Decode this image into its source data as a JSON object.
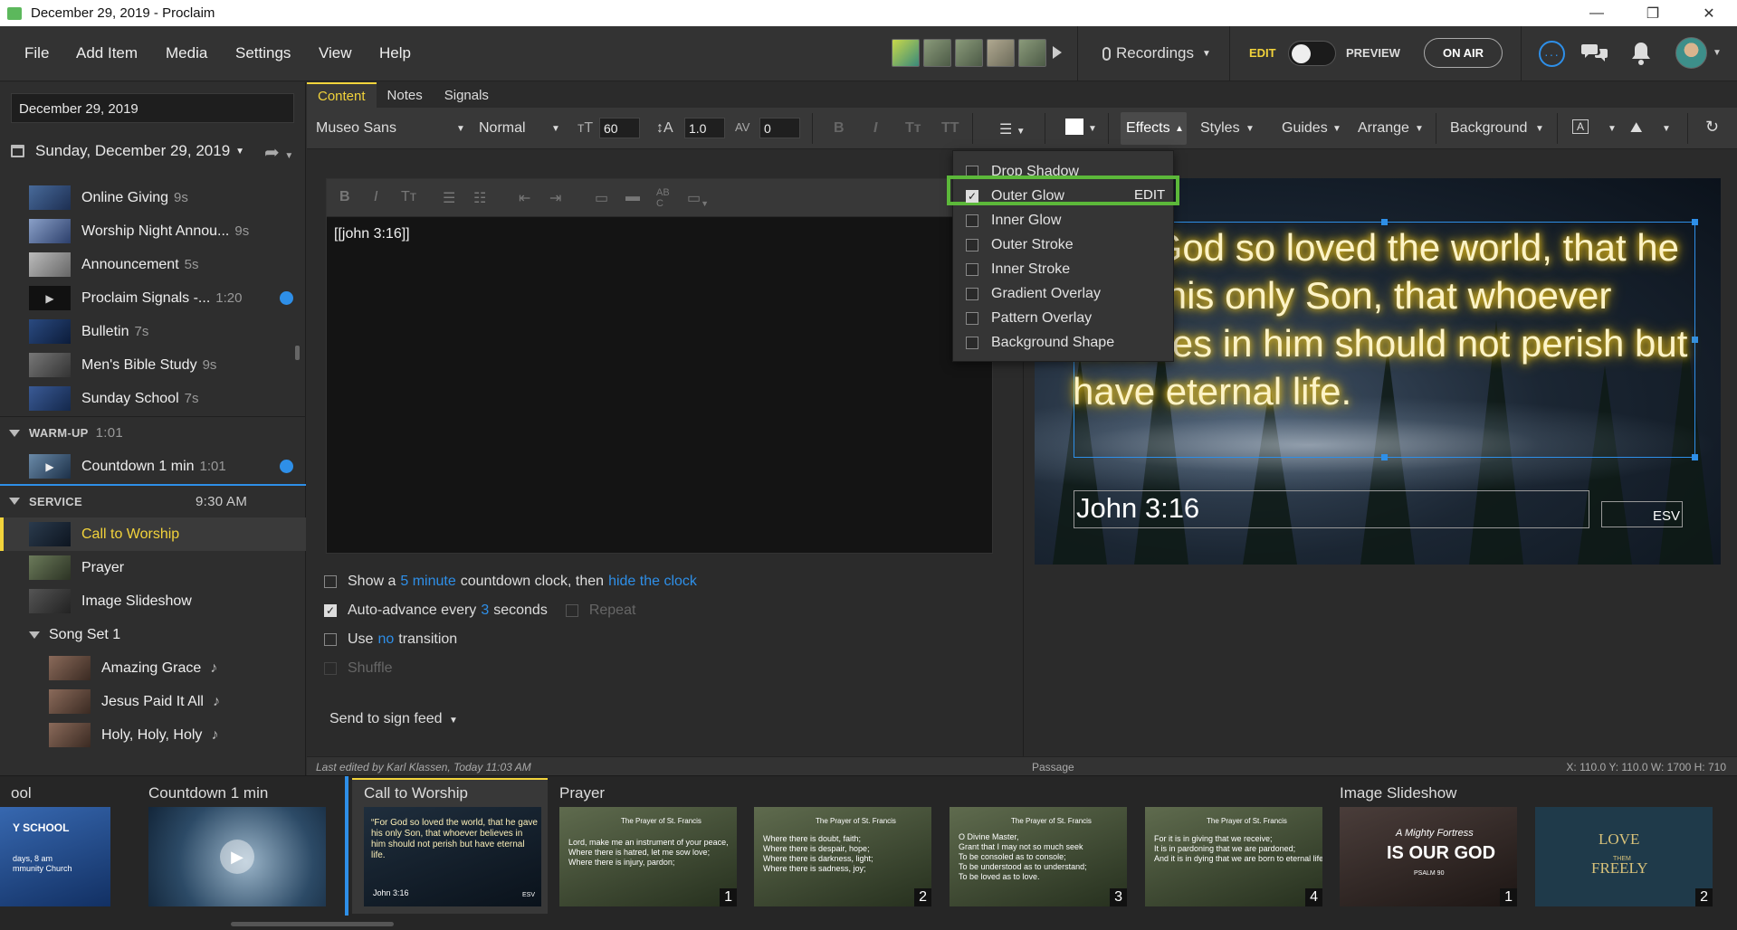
{
  "window": {
    "title": "December 29, 2019 - Proclaim",
    "minimize": "—",
    "restore": "❐",
    "close": "✕"
  },
  "menu": {
    "items": [
      "File",
      "Add Item",
      "Media",
      "Settings",
      "View",
      "Help"
    ]
  },
  "header": {
    "recordings": "Recordings",
    "edit": "EDIT",
    "preview": "PREVIEW",
    "on_air": "ON AIR"
  },
  "sidebar": {
    "date_value": "December 29, 2019",
    "day": "Sunday, December 29, 2019",
    "items": [
      {
        "label": "Online Giving",
        "dur": "9s"
      },
      {
        "label": "Worship Night Annou...",
        "dur": "9s"
      },
      {
        "label": "Announcement",
        "dur": "5s"
      },
      {
        "label": "Proclaim Signals -...",
        "dur": "1:20"
      },
      {
        "label": "Bulletin",
        "dur": "7s"
      },
      {
        "label": "Men's Bible Study",
        "dur": "9s"
      },
      {
        "label": "Sunday School",
        "dur": "7s"
      }
    ],
    "warmup": {
      "label": "WARM-UP",
      "time": "1:01"
    },
    "countdown": {
      "label": "Countdown 1 min",
      "dur": "1:01"
    },
    "service": {
      "label": "SERVICE",
      "time": "9:30 AM"
    },
    "service_items": [
      "Call to Worship",
      "Prayer",
      "Image Slideshow"
    ],
    "songset": "Song Set 1",
    "songs": [
      "Amazing Grace",
      "Jesus Paid It All",
      "Holy, Holy, Holy"
    ],
    "song_note": "♪"
  },
  "tabs": [
    "Content",
    "Notes",
    "Signals"
  ],
  "format": {
    "font": "Museo Sans",
    "weight": "Normal",
    "size": "60",
    "line_height": "1.0",
    "spacing": "0",
    "effects": "Effects",
    "styles": "Styles",
    "guides": "Guides",
    "arrange": "Arrange",
    "background": "Background"
  },
  "editor": {
    "text": "[[john 3:16]]",
    "opt1_a": "Show a",
    "opt1_link1": "5 minute",
    "opt1_b": "countdown clock, then",
    "opt1_link2": "hide the clock",
    "opt2_a": "Auto-advance every",
    "opt2_link": "3",
    "opt2_b": "seconds",
    "repeat": "Repeat",
    "opt3_a": "Use",
    "opt3_link": "no",
    "opt3_b": "transition",
    "shuffle": "Shuffle",
    "send": "Send to sign feed"
  },
  "slide": {
    "verse": "“For God so loved the world, that he gave his only Son, that whoever believes in him should not perish but have eternal life.",
    "ref": "John 3:16",
    "version": "ESV"
  },
  "effects_menu": {
    "items": [
      "Drop Shadow",
      "Outer Glow",
      "Inner Glow",
      "Outer Stroke",
      "Inner Stroke",
      "Gradient Overlay",
      "Pattern Overlay",
      "Background Shape"
    ],
    "checked_index": 1,
    "edit": "EDIT"
  },
  "status": {
    "last_edited": "Last edited by Karl Klassen, Today 11:03 AM",
    "panel": "Passage",
    "coords": "X: 110.0  Y: 110.0   W: 1700  H: 710"
  },
  "filmstrip": {
    "cut_title": "ool",
    "cut_text": "Y SCHOOL",
    "cut_sub": "days, 8 am\nmmunity Church",
    "countdown": "Countdown 1 min",
    "call": "Call to Worship",
    "call_ref": "John 3:16",
    "call_ver": "ESV",
    "call_verse": "“For God so loved the world, that he gave his only Son, that whoever believes in him should not perish but have eternal life.",
    "prayer": "Prayer",
    "prayer_title": "The Prayer of St. Francis",
    "prayer_slides": [
      "Lord, make me an instrument of your peace,\nWhere there is hatred, let me sow love;\nWhere there is injury, pardon;",
      "Where there is doubt, faith;\nWhere there is despair, hope;\nWhere there is darkness, light;\nWhere there is sadness, joy;",
      "O Divine Master,\nGrant that I may not so much seek\nTo be consoled as to console;\nTo be understood as to understand;\nTo be loved as to love.",
      "For it is in giving that we receive;\nIt is in pardoning that we are pardoned;\nAnd it is in dying that we are born to eternal life."
    ],
    "slide_nums": [
      "1",
      "2",
      "3",
      "4"
    ],
    "slideshow": "Image Slideshow",
    "ss1_a": "A Mighty Fortress",
    "ss1_b": "IS OUR GOD",
    "ss1_c": "PSALM 90",
    "ss2_a": "LOVE",
    "ss2_b": "THEM",
    "ss2_c": "FREELY",
    "ss_nums": [
      "1",
      "2"
    ]
  }
}
